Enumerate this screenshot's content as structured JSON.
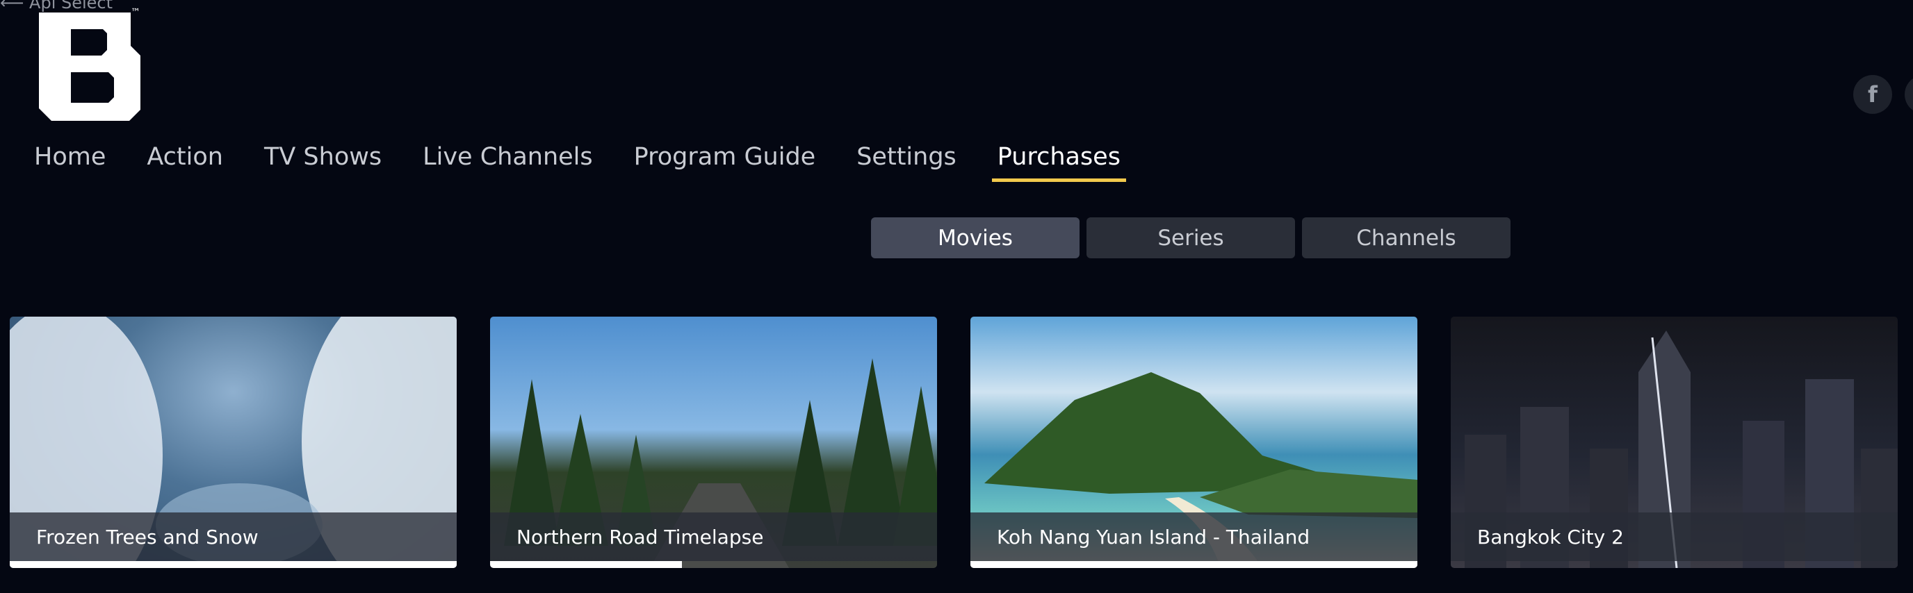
{
  "header": {
    "back_label": "⟵ Api Select",
    "logo_letter": "B",
    "logo_mark": "™",
    "social_icon": "facebook-icon",
    "social_glyph": "f"
  },
  "nav": {
    "items": [
      {
        "label": "Home"
      },
      {
        "label": "Action"
      },
      {
        "label": "TV Shows"
      },
      {
        "label": "Live Channels"
      },
      {
        "label": "Program Guide"
      },
      {
        "label": "Settings"
      },
      {
        "label": "Purchases",
        "active": true
      }
    ],
    "active_color": "#f2c94c"
  },
  "tabs": [
    {
      "label": "Movies",
      "active": true
    },
    {
      "label": "Series"
    },
    {
      "label": "Channels"
    }
  ],
  "cards": [
    {
      "title": "Frozen Trees and Snow",
      "progress": 1.0
    },
    {
      "title": "Northern Road Timelapse",
      "progress": 0.43
    },
    {
      "title": "Koh Nang Yuan Island - Thailand",
      "progress": 1.0
    },
    {
      "title": "Bangkok City 2",
      "progress": 0
    }
  ],
  "colors": {
    "background": "#040712",
    "accent": "#f2c94c"
  }
}
